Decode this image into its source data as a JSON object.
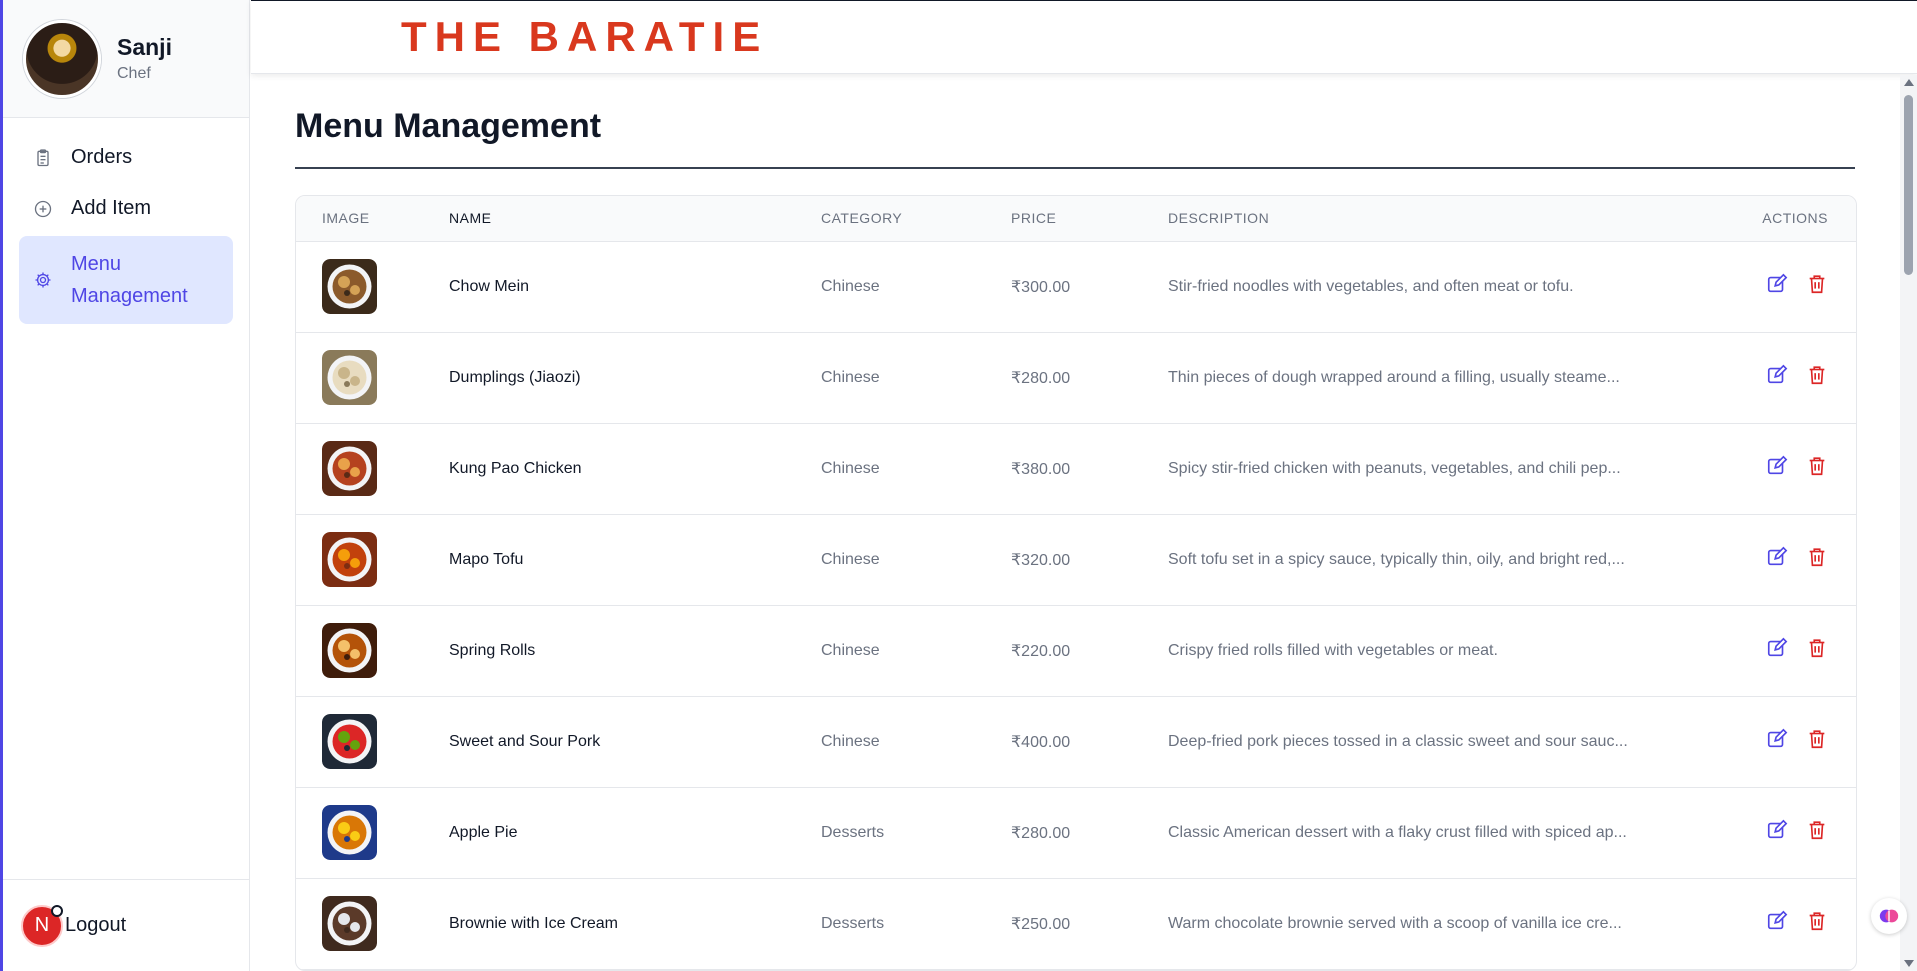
{
  "brand": {
    "title": "THE BARATIE",
    "color": "#d9381e"
  },
  "profile": {
    "name": "Sanji",
    "role": "Chef"
  },
  "nav": {
    "items": [
      {
        "label": "Orders",
        "icon": "clipboard-icon",
        "active": false
      },
      {
        "label": "Add Item",
        "icon": "plus-circle-icon",
        "active": false
      },
      {
        "label": "Menu Management",
        "icon": "gear-icon",
        "active": true
      }
    ]
  },
  "footer": {
    "badge": "N",
    "logout_label": "Logout"
  },
  "page": {
    "title": "Menu Management"
  },
  "table": {
    "headers": {
      "image": "IMAGE",
      "name": "NAME",
      "category": "CATEGORY",
      "price": "PRICE",
      "description": "DESCRIPTION",
      "actions": "ACTIONS"
    },
    "rows": [
      {
        "name": "Chow Mein",
        "category": "Chinese",
        "price": "₹300.00",
        "description": "Stir-fried noodles with vegetables, and often meat or tofu."
      },
      {
        "name": "Dumplings (Jiaozi)",
        "category": "Chinese",
        "price": "₹280.00",
        "description": "Thin pieces of dough wrapped around a filling, usually steame..."
      },
      {
        "name": "Kung Pao Chicken",
        "category": "Chinese",
        "price": "₹380.00",
        "description": "Spicy stir-fried chicken with peanuts, vegetables, and chili pep..."
      },
      {
        "name": "Mapo Tofu",
        "category": "Chinese",
        "price": "₹320.00",
        "description": "Soft tofu set in a spicy sauce, typically thin, oily, and bright red,..."
      },
      {
        "name": "Spring Rolls",
        "category": "Chinese",
        "price": "₹220.00",
        "description": "Crispy fried rolls filled with vegetables or meat."
      },
      {
        "name": "Sweet and Sour Pork",
        "category": "Chinese",
        "price": "₹400.00",
        "description": "Deep-fried pork pieces tossed in a classic sweet and sour sauc..."
      },
      {
        "name": "Apple Pie",
        "category": "Desserts",
        "price": "₹280.00",
        "description": "Classic American dessert with a flaky crust filled with spiced ap..."
      },
      {
        "name": "Brownie with Ice Cream",
        "category": "Desserts",
        "price": "₹250.00",
        "description": "Warm chocolate brownie served with a scoop of vanilla ice cre..."
      }
    ]
  },
  "colors": {
    "accent": "#4f46e5",
    "danger": "#dc2626",
    "edit": "#4f46e5"
  }
}
